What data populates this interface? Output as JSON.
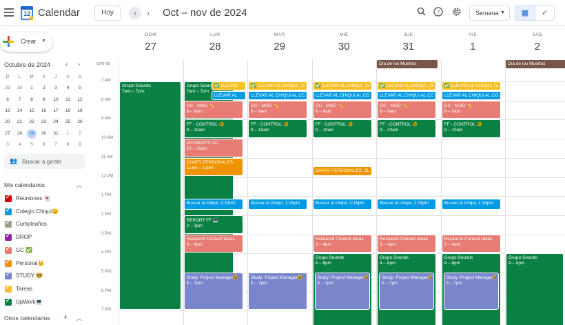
{
  "header": {
    "app_title": "Calendar",
    "logo_day": "12",
    "today_button": "Hoy",
    "date_range": "Oct – nov de 2024",
    "view": "Semana",
    "icons": [
      "menu-icon",
      "search-icon",
      "help-icon",
      "settings-icon",
      "calendar-view-icon",
      "tasks-view-icon"
    ]
  },
  "sidebar": {
    "create_label": "Crear",
    "mini_calendar": {
      "title": "Octubre de 2024",
      "weekdays": [
        "D",
        "L",
        "M",
        "X",
        "J",
        "V",
        "S"
      ],
      "weeks": [
        [
          "29",
          "30",
          "1",
          "2",
          "3",
          "4",
          "5"
        ],
        [
          "6",
          "7",
          "8",
          "9",
          "10",
          "11",
          "12"
        ],
        [
          "13",
          "14",
          "15",
          "16",
          "17",
          "18",
          "19"
        ],
        [
          "20",
          "21",
          "22",
          "23",
          "24",
          "25",
          "26"
        ],
        [
          "27",
          "28",
          "29",
          "30",
          "31",
          "1",
          "2"
        ],
        [
          "3",
          "4",
          "5",
          "6",
          "7",
          "8",
          "9"
        ]
      ],
      "today": "29"
    },
    "search_people": "Buscar a gente",
    "my_calendars_title": "Mis calendarios",
    "my_calendars": [
      {
        "label": "Reuniones 👻",
        "color": "#d50000"
      },
      {
        "label": "Colegio Chiqui😉",
        "color": "#039be5"
      },
      {
        "label": "Cumpleaños",
        "color": "#a79b8e"
      },
      {
        "label": "DROP",
        "color": "#8e24aa"
      },
      {
        "label": "GC ✅",
        "color": "#e67c73"
      },
      {
        "label": "Personal👑",
        "color": "#f09300"
      },
      {
        "label": "STUDY 🤓",
        "color": "#7986cb"
      },
      {
        "label": "Tareas",
        "color": "#f6bf26"
      },
      {
        "label": "UpWork💻",
        "color": "#0b8043"
      }
    ],
    "other_calendars_title": "Otros calendarios"
  },
  "grid": {
    "timezone": "GMT-05",
    "days": [
      {
        "dow": "DOM",
        "num": "27"
      },
      {
        "dow": "LUN",
        "num": "28"
      },
      {
        "dow": "MAR",
        "num": "29"
      },
      {
        "dow": "MIÉ",
        "num": "30"
      },
      {
        "dow": "JUE",
        "num": "31"
      },
      {
        "dow": "VIE",
        "num": "1"
      },
      {
        "dow": "SÁB",
        "num": "2"
      }
    ],
    "times": [
      "7 AM",
      "8 AM",
      "9 AM",
      "10 AM",
      "11 AM",
      "12 PM",
      "1 PM",
      "2 PM",
      "3 PM",
      "4 PM",
      "5 PM",
      "6 PM",
      "7 PM"
    ],
    "all_day": [
      "Día de los Muertos",
      "Día de los Muertos"
    ],
    "events": {
      "grupo_sounds": "Grupo Sounds",
      "grupo_sounds_sun_time": "7am – 7pm",
      "grupo_sounds_mon": "Grupo Sounds",
      "grupo_sounds_mon_time": "7am – 7pm",
      "llevar": "✅ LLEVAR AL CHIQUI, 7am",
      "llevar_short": "✅ LLEVAR",
      "llevar_blue": "LLEVAR AL CHIQUI AL COLEGIO",
      "llevar_blue_short": "LLEVAR AL",
      "gc_mod": "GC - MOD ✏️",
      "gc_mod_time": "8 – 9am",
      "ff_control": "FF - CONTROL 🐠",
      "ff_control_time": "9 – 10am",
      "payments": "PAYMENTS GC",
      "payments_time": "10 – 11am",
      "chats": "CHATS PERSONALES",
      "chats_time": "11am – 12pm",
      "chats_wed": "CHATS PERSONALES, 11am",
      "buscar": "Buscar al chiqui, 1:15pm",
      "report": "REPORT FF 💻",
      "report_time": "2 – 3pm",
      "research": "Research Content Ideas",
      "research_time": "3 – 4pm",
      "grupo_afternoon": "Grupo Sounds",
      "grupo_afternoon_time": "4 – 8pm",
      "study": "Study: Project Manager🤓",
      "study_time": "5 – 7pm"
    }
  },
  "colors": {
    "accent": "#1a73e8",
    "upwork": "#0b8043",
    "gc": "#e67c73",
    "personal": "#f09300",
    "tareas": "#f6bf26",
    "colegio": "#039be5",
    "study": "#7986cb",
    "holiday": "#795548"
  }
}
